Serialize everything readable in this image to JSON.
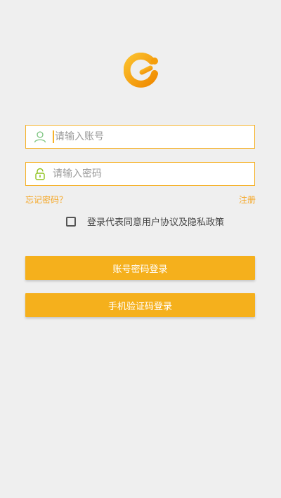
{
  "colors": {
    "accent": "#f5b01c",
    "link": "#f5a623",
    "icon_user": "#7bc47f",
    "icon_lock": "#8fc31f",
    "background": "#efefef"
  },
  "logo": {
    "icon": "brand-logo-icon"
  },
  "account_field": {
    "icon": "user-icon",
    "placeholder": "请输入账号",
    "value": ""
  },
  "password_field": {
    "icon": "lock-icon",
    "placeholder": "请输入密码",
    "value": ""
  },
  "links": {
    "forgot_password": "忘记密码？",
    "register": "注册"
  },
  "agreement": {
    "checked": false,
    "text": "登录代表同意用户协议及隐私政策"
  },
  "buttons": {
    "account_login": "账号密码登录",
    "phone_login": "手机验证码登录"
  }
}
